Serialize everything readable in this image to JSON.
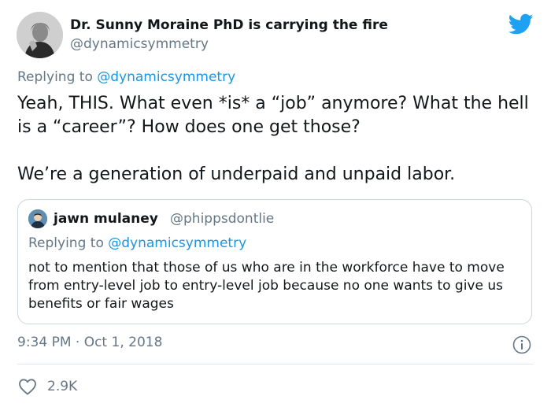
{
  "author": {
    "name": "Dr. Sunny Moraine PhD is carrying the fire",
    "handle": "@dynamicsymmetry",
    "avatar_icon": "author-avatar"
  },
  "brand": {
    "icon": "twitter-bird-icon",
    "color": "#1da1f2"
  },
  "reply": {
    "prefix": "Replying to",
    "handle": "@dynamicsymmetry"
  },
  "tweet": {
    "paragraphs": [
      "Yeah, THIS. What even *is* a “job” anymore? What the hell is a “career”? How does one get those?",
      "We’re a generation of underpaid and unpaid labor."
    ]
  },
  "quote": {
    "name": "jawn mulaney",
    "handle": "@phippsdontlie",
    "reply_prefix": "Replying to",
    "reply_handle": "@dynamicsymmetry",
    "text": "not to mention that those of us who are in the workforce have to move from entry-level job to entry-level job because no one wants to give us benefits or fair wages"
  },
  "meta": {
    "timestamp": "9:34 PM · Oct 1, 2018",
    "info_icon": "info-icon"
  },
  "actions": {
    "like_icon": "heart-icon",
    "like_count": "2.9K"
  },
  "colors": {
    "text": "#14171a",
    "secondary": "#657786",
    "link": "#1b95e0",
    "border": "#ccd6dd"
  }
}
